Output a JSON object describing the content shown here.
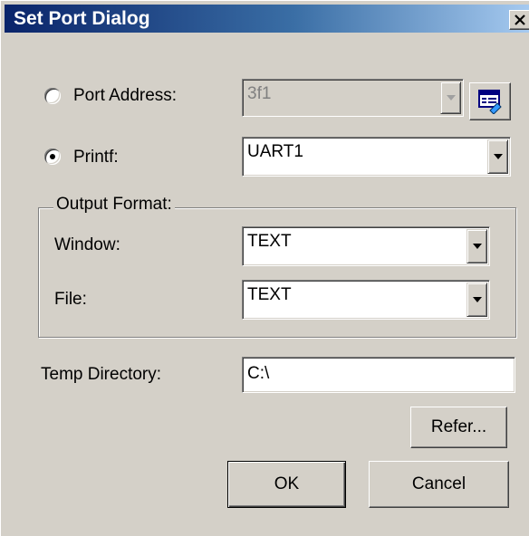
{
  "dialog": {
    "title": "Set Port Dialog",
    "close_symbol": "✕"
  },
  "port_address": {
    "label": "Port Address:",
    "selected": false,
    "value": "3f1",
    "enabled": false,
    "browse_icon": "port-browse-icon"
  },
  "printf": {
    "label": "Printf:",
    "selected": true,
    "value": "UART1"
  },
  "output_format": {
    "group_label": "Output Format:",
    "window_label": "Window:",
    "window_value": "TEXT",
    "file_label": "File:",
    "file_value": "TEXT"
  },
  "temp_directory": {
    "label": "Temp Directory:",
    "value": "C:\\"
  },
  "buttons": {
    "refer": "Refer...",
    "ok": "OK",
    "cancel": "Cancel"
  },
  "icons": {
    "dropdown": "chevron-down-icon",
    "close": "close-icon"
  }
}
